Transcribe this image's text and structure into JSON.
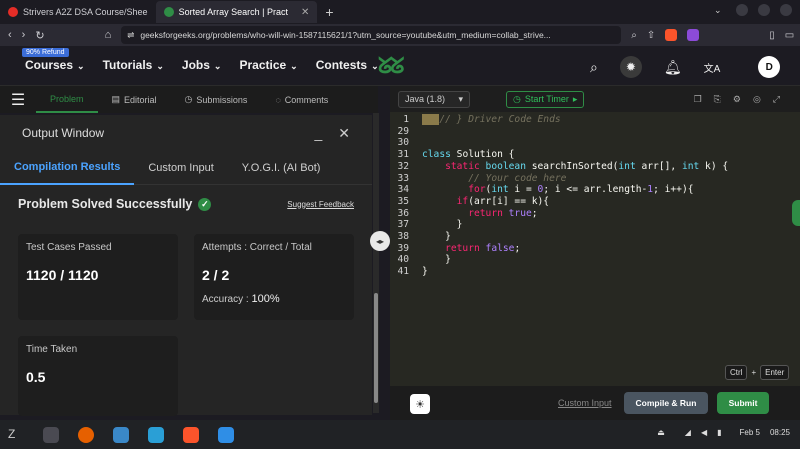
{
  "browser": {
    "tabs": [
      {
        "label": "Strivers A2Z DSA Course/Shee",
        "color": "#e52d27",
        "active": false
      },
      {
        "label": "Sorted Array Search | Pract",
        "color": "#2f8d46",
        "active": true
      }
    ],
    "new_tab": "+",
    "url": "geeksforgeeks.org/problems/who-will-win-1587115621/1?utm_source=youtube&utm_medium=collab_strive..."
  },
  "nav": {
    "refund_badge": "90% Refund",
    "items": [
      "Courses",
      "Tutorials",
      "Jobs",
      "Practice",
      "Contests"
    ],
    "logo": "GG",
    "avatar": "D"
  },
  "left_tabs": {
    "problem": "Problem",
    "editorial": "Editorial",
    "submissions": "Submissions",
    "comments": "Comments"
  },
  "output_window": {
    "title": "Output Window",
    "tabs": [
      "Compilation Results",
      "Custom Input",
      "Y.O.G.I. (AI Bot)"
    ],
    "status": "Problem Solved Successfully",
    "suggest_feedback": "Suggest Feedback",
    "test_cases_label": "Test Cases Passed",
    "test_cases_value": "1120 / 1120",
    "attempts_label": "Attempts : Correct / Total",
    "attempts_value": "2 / 2",
    "accuracy_label": "Accuracy :",
    "accuracy_value": "100%",
    "time_label": "Time Taken",
    "time_value": "0.5"
  },
  "editor": {
    "language": "Java (1.8)",
    "timer": "Start Timer",
    "lines": [
      {
        "n": "1",
        "html": "<span class=\"fold\">===</span><span class=\"cm\">// } Driver Code Ends</span>"
      },
      {
        "n": "29",
        "html": ""
      },
      {
        "n": "30",
        "html": ""
      },
      {
        "n": "31",
        "html": "<span class=\"ty\">class</span> Solution {"
      },
      {
        "n": "32",
        "html": "    <span class=\"kw\">static</span> <span class=\"ty\">boolean</span> searchInSorted(<span class=\"ty\">int</span> arr[], <span class=\"ty\">int</span> k) {"
      },
      {
        "n": "33",
        "html": "        <span class=\"cm\">// Your code here</span>"
      },
      {
        "n": "34",
        "html": "        <span class=\"kw\">for</span>(<span class=\"ty\">int</span> i = <span class=\"nm\">0</span>; i &lt;= arr.length-<span class=\"nm\">1</span>; i++){"
      },
      {
        "n": "35",
        "html": "      <span class=\"kw\">if</span>(arr[i] == k){"
      },
      {
        "n": "36",
        "html": "        <span class=\"kw\">return</span> <span class=\"nm\">true</span>;"
      },
      {
        "n": "37",
        "html": "      }"
      },
      {
        "n": "38",
        "html": "    }"
      },
      {
        "n": "39",
        "html": "    <span class=\"kw\">return</span> <span class=\"nm\">false</span>;"
      },
      {
        "n": "40",
        "html": "    }"
      },
      {
        "n": "41",
        "html": "}"
      }
    ],
    "custom_input": "Custom Input",
    "compile_run": "Compile & Run",
    "submit": "Submit",
    "shortcut_ctrl": "Ctrl",
    "shortcut_plus": "+",
    "shortcut_enter": "Enter"
  },
  "taskbar": {
    "date": "Feb 5",
    "time": "08:25"
  }
}
